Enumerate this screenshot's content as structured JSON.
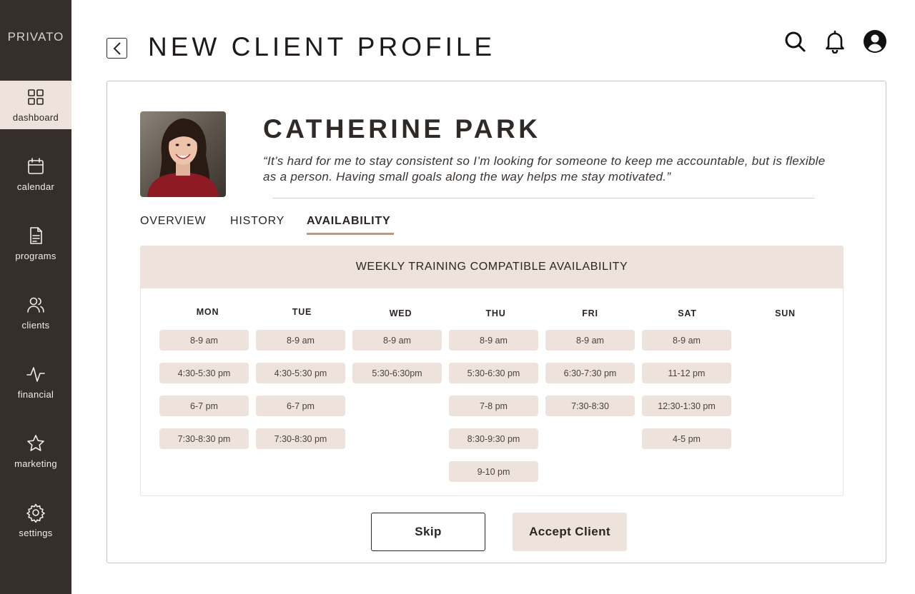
{
  "app": {
    "logo": "PRIVATO"
  },
  "sidebar": {
    "items": [
      {
        "label": "dashboard",
        "icon": "grid-icon",
        "active": true
      },
      {
        "label": "calendar",
        "icon": "calendar-icon",
        "active": false
      },
      {
        "label": "programs",
        "icon": "document-icon",
        "active": false
      },
      {
        "label": "clients",
        "icon": "users-icon",
        "active": false
      },
      {
        "label": "financial",
        "icon": "activity-icon",
        "active": false
      },
      {
        "label": "marketing",
        "icon": "star-icon",
        "active": false
      },
      {
        "label": "settings",
        "icon": "gear-icon",
        "active": false
      }
    ]
  },
  "header": {
    "title": "NEW CLIENT PROFILE",
    "icons": [
      "search-icon",
      "bell-icon",
      "user-account-icon"
    ]
  },
  "client": {
    "name": "CATHERINE PARK",
    "quote": "“It’s hard for me to stay consistent so I’m looking for someone to keep me accountable, but is flexible as a person. Having small goals along the way helps me stay motivated.”"
  },
  "tabs": [
    {
      "label": "OVERVIEW",
      "active": false
    },
    {
      "label": "HISTORY",
      "active": false
    },
    {
      "label": "AVAILABILITY",
      "active": true
    }
  ],
  "availability": {
    "title": "WEEKLY TRAINING COMPATIBLE AVAILABILITY",
    "days": [
      {
        "day": "MON",
        "slots": [
          "8-9 am",
          "4:30-5:30 pm",
          "6-7 pm",
          "7:30-8:30 pm"
        ]
      },
      {
        "day": "TUE",
        "slots": [
          "8-9 am",
          "4:30-5:30 pm",
          "6-7 pm",
          "7:30-8:30 pm"
        ]
      },
      {
        "day": "WED",
        "slots": [
          "8-9 am",
          "5:30-6:30pm"
        ]
      },
      {
        "day": "THU",
        "slots": [
          "8-9 am",
          "5:30-6:30 pm",
          "7-8 pm",
          "8:30-9:30 pm",
          "9-10 pm"
        ]
      },
      {
        "day": "FRI",
        "slots": [
          "8-9 am",
          "6:30-7:30 pm",
          "7:30-8:30"
        ]
      },
      {
        "day": "SAT",
        "slots": [
          "8-9 am",
          "11-12 pm",
          "12:30-1:30 pm",
          "4-5 pm"
        ]
      },
      {
        "day": "SUN",
        "slots": []
      }
    ]
  },
  "actions": {
    "skip": "Skip",
    "accept": "Accept Client"
  },
  "colors": {
    "sidebar": "#362e2a",
    "accent_bg": "#ede3dc",
    "tab_underline": "#b59a85"
  }
}
